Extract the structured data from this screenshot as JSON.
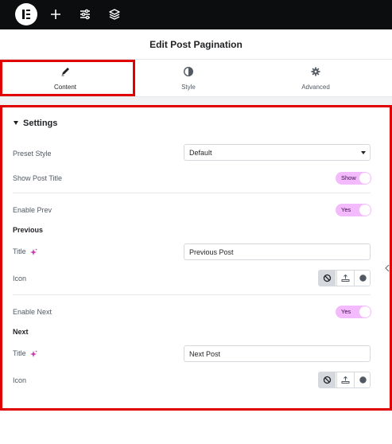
{
  "topbar": {
    "icons": [
      "elementor-logo-icon",
      "plus-icon",
      "sliders-icon",
      "layers-icon"
    ]
  },
  "header": {
    "title": "Edit Post Pagination"
  },
  "tabs": [
    {
      "label": "Content",
      "icon": "pencil-icon",
      "active": true
    },
    {
      "label": "Style",
      "icon": "half-circle-icon",
      "active": false
    },
    {
      "label": "Advanced",
      "icon": "gear-icon",
      "active": false
    }
  ],
  "settings": {
    "section_title": "Settings",
    "preset_style": {
      "label": "Preset Style",
      "value": "Default"
    },
    "show_post_title": {
      "label": "Show Post Title",
      "toggle": "Show"
    },
    "enable_prev": {
      "label": "Enable Prev",
      "toggle": "Yes"
    },
    "previous": {
      "heading": "Previous",
      "title_label": "Title",
      "title_value": "Previous Post",
      "icon_label": "Icon"
    },
    "enable_next": {
      "label": "Enable Next",
      "toggle": "Yes"
    },
    "next": {
      "heading": "Next",
      "title_label": "Title",
      "title_value": "Next Post",
      "icon_label": "Icon"
    },
    "icon_choices": [
      "none-icon",
      "upload-icon",
      "circle-icon"
    ]
  },
  "colors": {
    "accent_toggle": "#f3bafd",
    "highlight": "#e00000",
    "topbar": "#0c0d0e"
  }
}
